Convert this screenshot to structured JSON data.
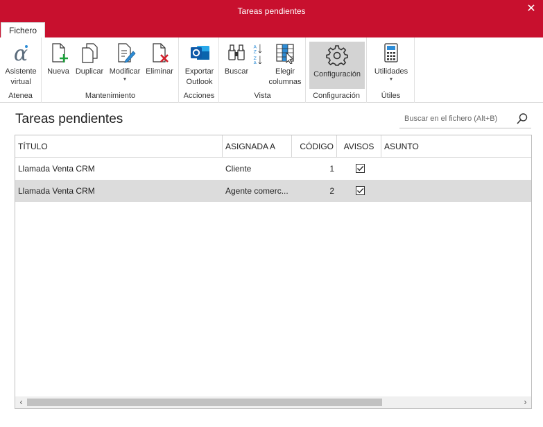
{
  "window": {
    "title": "Tareas pendientes",
    "close_glyph": "✕"
  },
  "tabs": {
    "file_label": "Fichero"
  },
  "ribbon": {
    "groups": [
      {
        "label": "Atenea",
        "buttons": [
          {
            "label": "Asistente\nvirtual",
            "icon": "alpha-assistant-icon"
          }
        ]
      },
      {
        "label": "Mantenimiento",
        "buttons": [
          {
            "label": "Nueva",
            "icon": "new-document-icon"
          },
          {
            "label": "Duplicar",
            "icon": "duplicate-icon"
          },
          {
            "label": "Modificar",
            "icon": "edit-document-icon",
            "dropdown": true
          },
          {
            "label": "Eliminar",
            "icon": "delete-document-icon"
          }
        ]
      },
      {
        "label": "Acciones",
        "buttons": [
          {
            "label": "Exportar\nOutlook",
            "icon": "outlook-icon"
          }
        ]
      },
      {
        "label": "Vista",
        "buttons": [
          {
            "label": "Buscar",
            "icon": "binoculars-icon"
          },
          {
            "label": "",
            "icon": "sort-az-icon"
          },
          {
            "label": "Elegir\ncolumnas",
            "icon": "choose-columns-icon"
          }
        ]
      },
      {
        "label": "Configuración",
        "buttons": [
          {
            "label": "Configuración",
            "icon": "gear-icon",
            "active": true
          }
        ]
      },
      {
        "label": "Útiles",
        "buttons": [
          {
            "label": "Utilidades",
            "icon": "calculator-icon",
            "dropdown": true
          }
        ]
      }
    ]
  },
  "main": {
    "title": "Tareas pendientes",
    "search_placeholder": "Buscar en el fichero (Alt+B)"
  },
  "grid": {
    "columns": [
      "TÍTULO",
      "ASIGNADA A",
      "CÓDIGO",
      "AVISOS",
      "ASUNTO"
    ],
    "rows": [
      {
        "titulo": "Llamada Venta CRM",
        "asignada": "Cliente",
        "codigo": "1",
        "avisos": true,
        "asunto": ""
      },
      {
        "titulo": "Llamada Venta CRM",
        "asignada": "Agente comerc...",
        "codigo": "2",
        "avisos": true,
        "asunto": "",
        "selected": true
      }
    ]
  },
  "colors": {
    "brand": "#c8102e",
    "selected_row": "#dcdcdc",
    "active_button": "#d3d3d3"
  }
}
